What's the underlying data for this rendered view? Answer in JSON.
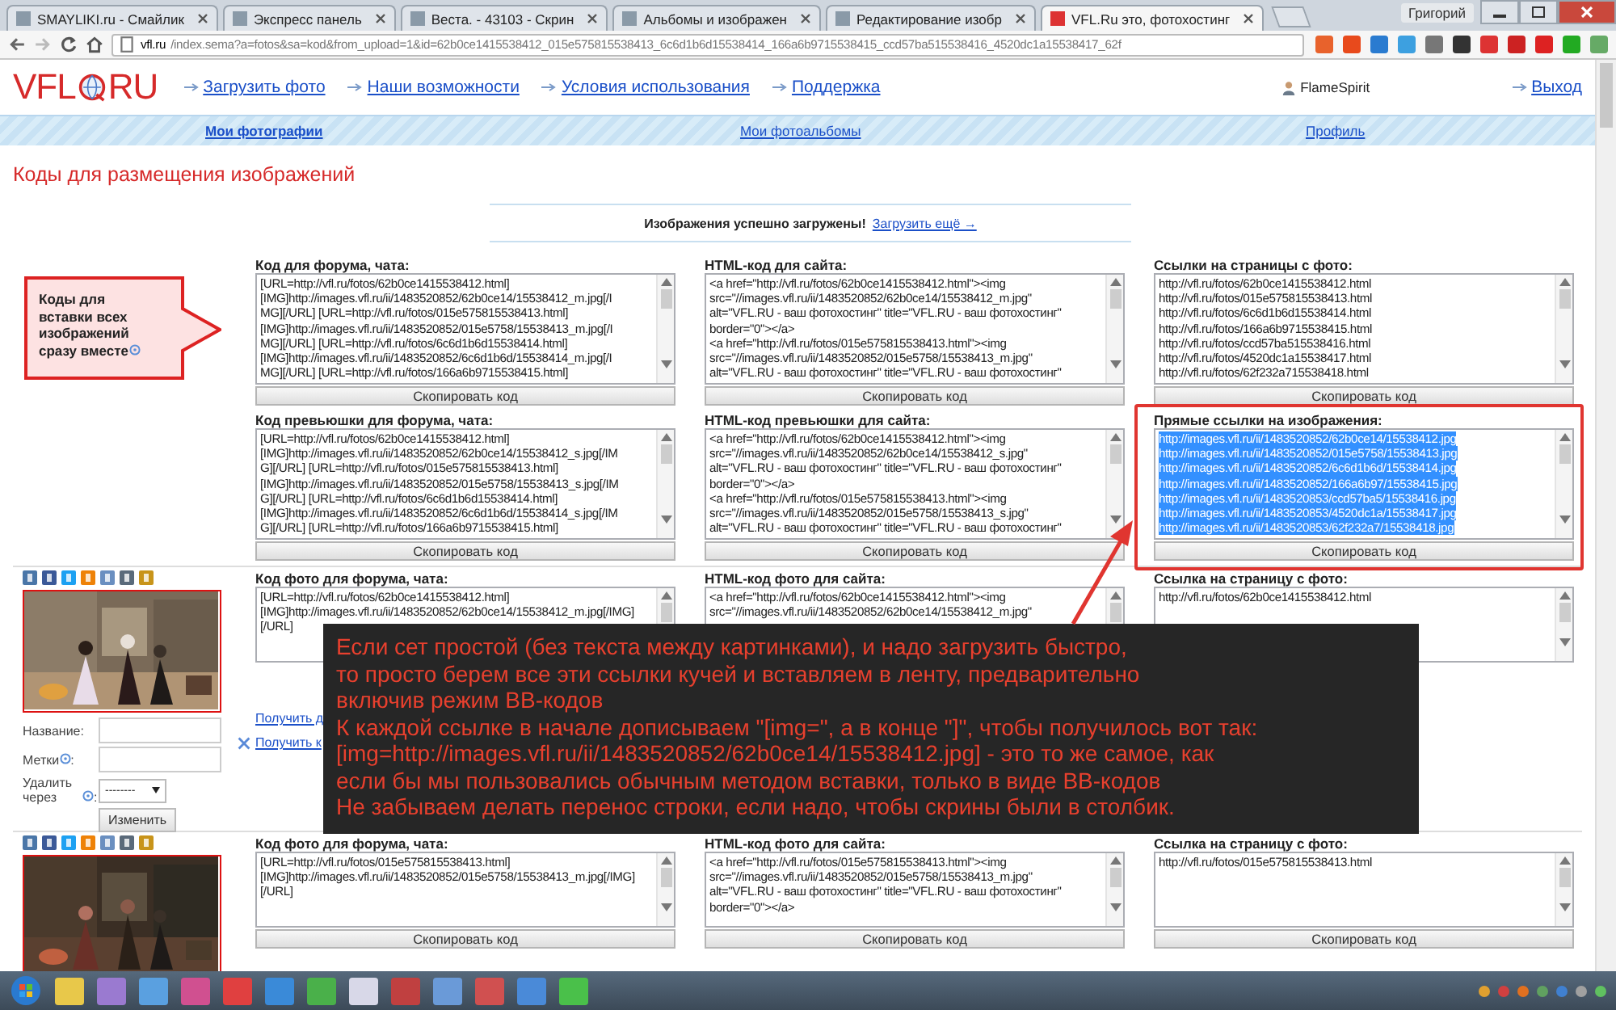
{
  "browser": {
    "tabs": [
      {
        "title": "SMAYLIKI.ru - Смайлик",
        "selected": false
      },
      {
        "title": "Экспресс панель",
        "selected": false
      },
      {
        "title": "Веста. - 43103 - Скрин",
        "selected": false
      },
      {
        "title": "Альбомы и изображен",
        "selected": false
      },
      {
        "title": "Редактирование изобр",
        "selected": false
      },
      {
        "title": "VFL.Ru это, фотохостинг",
        "selected": true
      }
    ],
    "user": "Григорий",
    "url_host": "vfl.ru",
    "url_path": "/index.sema?a=fotos&sa=kod&from_upload=1&id=62b0ce1415538412_015e575815538413_6c6d1b6d15538414_166a6b9715538415_ccd57ba515538416_4520dc1a15538417_62f"
  },
  "site": {
    "logo_left": "VFL",
    "logo_right": "RU",
    "nav": [
      "Загрузить фото",
      "Наши возможности",
      "Условия использования",
      "Поддержка"
    ],
    "user": "FlameSpirit",
    "logout": "Выход",
    "subnav": [
      {
        "label": "Мои фотографии",
        "selected": true
      },
      {
        "label": "Мои фотоальбомы",
        "selected": false
      },
      {
        "label": "Профиль",
        "selected": false
      }
    ]
  },
  "title": "Коды для размещения изображений",
  "notice": {
    "text": "Изображения успешно загружены!",
    "link": "Загрузить ещё →"
  },
  "callout": "Коды для вставки всех изображений сразу вместе",
  "code_blocks": [
    {
      "label": "Код для форума, чата:",
      "text_selected": false,
      "outlined": false,
      "button": "Скопировать код",
      "lines": [
        "[URL=http://vfl.ru/fotos/62b0ce1415538412.html]",
        "[IMG]http://images.vfl.ru/ii/1483520852/62b0ce14/15538412_m.jpg[/I",
        "MG][/URL] [URL=http://vfl.ru/fotos/015e575815538413.html]",
        "[IMG]http://images.vfl.ru/ii/1483520852/015e5758/15538413_m.jpg[/I",
        "MG][/URL] [URL=http://vfl.ru/fotos/6c6d1b6d15538414.html]",
        "[IMG]http://images.vfl.ru/ii/1483520852/6c6d1b6d/15538414_m.jpg[/I",
        "MG][/URL] [URL=http://vfl.ru/fotos/166a6b9715538415.html]"
      ]
    },
    {
      "label": "HTML-код для сайта:",
      "text_selected": false,
      "outlined": false,
      "button": "Скопировать код",
      "lines": [
        "<a href=\"http://vfl.ru/fotos/62b0ce1415538412.html\"><img",
        "src=\"//images.vfl.ru/ii/1483520852/62b0ce14/15538412_m.jpg\"",
        "alt=\"VFL.RU - ваш фотохостинг\" title=\"VFL.RU - ваш фотохостинг\"",
        "border=\"0\"></a>",
        "<a href=\"http://vfl.ru/fotos/015e575815538413.html\"><img",
        "src=\"//images.vfl.ru/ii/1483520852/015e5758/15538413_m.jpg\"",
        "alt=\"VFL.RU - ваш фотохостинг\" title=\"VFL.RU - ваш фотохостинг\""
      ]
    },
    {
      "label": "Ссылки на страницы с фото:",
      "text_selected": false,
      "outlined": false,
      "button": "Скопировать код",
      "lines": [
        "http://vfl.ru/fotos/62b0ce1415538412.html",
        "http://vfl.ru/fotos/015e575815538413.html",
        "http://vfl.ru/fotos/6c6d1b6d15538414.html",
        "http://vfl.ru/fotos/166a6b9715538415.html",
        "http://vfl.ru/fotos/ccd57ba515538416.html",
        "http://vfl.ru/fotos/4520dc1a15538417.html",
        "http://vfl.ru/fotos/62f232a715538418.html"
      ]
    },
    {
      "label": "Код превьюшки для форума, чата:",
      "text_selected": false,
      "outlined": false,
      "button": "Скопировать код",
      "lines": [
        "[URL=http://vfl.ru/fotos/62b0ce1415538412.html]",
        "[IMG]http://images.vfl.ru/ii/1483520852/62b0ce14/15538412_s.jpg[/IM",
        "G][/URL] [URL=http://vfl.ru/fotos/015e575815538413.html]",
        "[IMG]http://images.vfl.ru/ii/1483520852/015e5758/15538413_s.jpg[/IM",
        "G][/URL] [URL=http://vfl.ru/fotos/6c6d1b6d15538414.html]",
        "[IMG]http://images.vfl.ru/ii/1483520852/6c6d1b6d/15538414_s.jpg[/IM",
        "G][/URL] [URL=http://vfl.ru/fotos/166a6b9715538415.html]"
      ]
    },
    {
      "label": "HTML-код превьюшки для сайта:",
      "text_selected": false,
      "outlined": false,
      "button": "Скопировать код",
      "lines": [
        "<a href=\"http://vfl.ru/fotos/62b0ce1415538412.html\"><img",
        "src=\"//images.vfl.ru/ii/1483520852/62b0ce14/15538412_s.jpg\"",
        "alt=\"VFL.RU - ваш фотохостинг\" title=\"VFL.RU - ваш фотохостинг\"",
        "border=\"0\"></a>",
        "<a href=\"http://vfl.ru/fotos/015e575815538413.html\"><img",
        "src=\"//images.vfl.ru/ii/1483520852/015e5758/15538413_s.jpg\"",
        "alt=\"VFL.RU - ваш фотохостинг\" title=\"VFL.RU - ваш фотохостинг\""
      ]
    },
    {
      "label": "Прямые ссылки на изображения:",
      "text_selected": true,
      "outlined": true,
      "button": "Скопировать код",
      "lines": [
        "http://images.vfl.ru/ii/1483520852/62b0ce14/15538412.jpg",
        "http://images.vfl.ru/ii/1483520852/015e5758/15538413.jpg",
        "http://images.vfl.ru/ii/1483520852/6c6d1b6d/15538414.jpg",
        "http://images.vfl.ru/ii/1483520852/166a6b97/15538415.jpg",
        "http://images.vfl.ru/ii/1483520853/ccd57ba5/15538416.jpg",
        "http://images.vfl.ru/ii/1483520853/4520dc1a/15538417.jpg",
        "http://images.vfl.ru/ii/1483520853/62f232a7/15538418.jpg"
      ]
    }
  ],
  "photos": [
    {
      "picture": {
        "kind": "picture"
      },
      "fields": [
        {
          "kind": "text",
          "label": "Название:",
          "info": false
        },
        {
          "kind": "text",
          "label": "Метки",
          "info": true,
          "suffix": ":"
        },
        {
          "kind": "select",
          "label": "Удалить через",
          "info": true,
          "suffix": ":",
          "value": "--------"
        }
      ],
      "submit": "Изменить",
      "links": [
        {
          "text": "Получить д",
          "icon": false
        },
        {
          "text": "Получить к",
          "icon": true
        }
      ],
      "blocks": [
        {
          "label": "Код фото для форума, чата:",
          "lines": [
            "[URL=http://vfl.ru/fotos/62b0ce1415538412.html]",
            "[IMG]http://images.vfl.ru/ii/1483520852/62b0ce14/15538412_m.jpg[/IMG]",
            "[/URL]"
          ]
        },
        {
          "label": "HTML-код фото для сайта:",
          "lines": [
            "<a href=\"http://vfl.ru/fotos/62b0ce1415538412.html\"><img",
            "src=\"//images.vfl.ru/ii/1483520852/62b0ce14/15538412_m.jpg\""
          ]
        },
        {
          "label": "Ссылка на страницу с фото:",
          "lines": [
            "http://vfl.ru/fotos/62b0ce1415538412.html"
          ]
        }
      ]
    },
    {
      "picture": {
        "kind": "picture"
      },
      "blocks": [
        {
          "label": "Код фото для форума, чата:",
          "button": "Скопировать код",
          "lines": [
            "[URL=http://vfl.ru/fotos/015e575815538413.html]",
            "[IMG]http://images.vfl.ru/ii/1483520852/015e5758/15538413_m.jpg[/IMG]",
            "[/URL]"
          ]
        },
        {
          "label": "HTML-код фото для сайта:",
          "button": "Скопировать код",
          "lines": [
            "<a href=\"http://vfl.ru/fotos/015e575815538413.html\"><img",
            "src=\"//images.vfl.ru/ii/1483520852/015e5758/15538413_m.jpg\"",
            "alt=\"VFL.RU - ваш фотохостинг\" title=\"VFL.RU - ваш фотохостинг\"",
            "border=\"0\"></a>"
          ]
        },
        {
          "label": "Ссылка на страницу с фото:",
          "button": "Скопировать код",
          "lines": [
            "http://vfl.ru/fotos/015e575815538413.html"
          ]
        }
      ]
    }
  ],
  "annotation": {
    "lines": [
      "Если сет простой (без текста между картинками), и надо загрузить быстро,",
      "то просто берем все эти ссылки кучей и вставляем в ленту, предварительно",
      "включив режим BB-кодов",
      "К каждой ссылке в начале дописываем \"[img=\", а в конце \"]\", чтобы получилось вот так:",
      "[img=http://images.vfl.ru/ii/1483520852/62b0ce14/15538412.jpg] - это то же самое, как",
      "если бы мы пользовались обычным методом вставки, только в виде BB-кодов",
      "Не забываем делать перенос строки, если надо, чтобы скрины были в столбик."
    ]
  }
}
